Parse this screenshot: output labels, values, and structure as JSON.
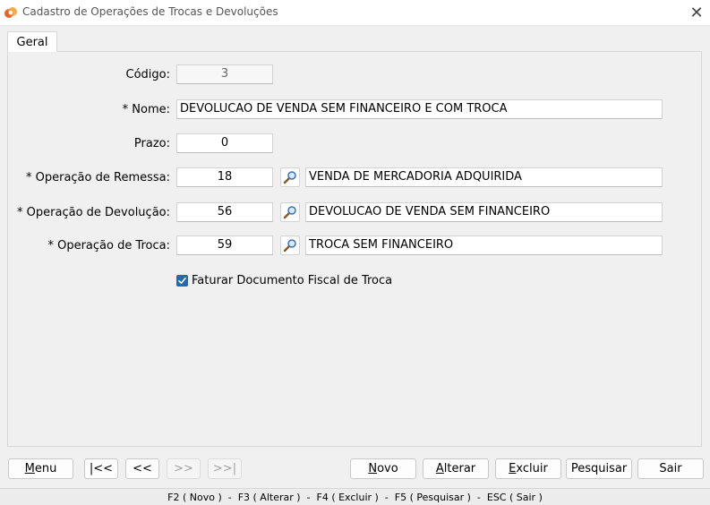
{
  "window": {
    "title": "Cadastro de Operações de Trocas e Devoluções",
    "close_glyph": "✕"
  },
  "tabs": [
    {
      "label": "Geral",
      "active": true
    }
  ],
  "form": {
    "codigo": {
      "label": "Código:",
      "value": "3"
    },
    "nome": {
      "label": "* Nome:",
      "value": "DEVOLUCAO DE VENDA SEM FINANCEIRO E COM TROCA"
    },
    "prazo": {
      "label": "Prazo:",
      "value": "0"
    },
    "remessa": {
      "label": "* Operação de Remessa:",
      "code": "18",
      "description": "VENDA DE MERCADORIA ADQUIRIDA"
    },
    "devolucao": {
      "label": "* Operação de Devolução:",
      "code": "56",
      "description": "DEVOLUCAO DE VENDA SEM FINANCEIRO"
    },
    "troca": {
      "label": "* Operação de Troca:",
      "code": "59",
      "description": "TROCA SEM FINANCEIRO"
    },
    "faturar": {
      "label": "Faturar Documento Fiscal de Troca",
      "checked": true
    }
  },
  "buttons": {
    "menu": {
      "mnemonic": "M",
      "rest": "enu"
    },
    "first": "|<<",
    "prev": "<<",
    "next": ">>",
    "last": ">>|",
    "novo": {
      "mnemonic": "N",
      "rest": "ovo"
    },
    "alterar": {
      "mnemonic": "A",
      "rest": "lterar"
    },
    "excluir": {
      "mnemonic": "E",
      "rest": "xcluir"
    },
    "pesquisar": "Pesquisar",
    "sair": "Sair"
  },
  "status": "F2 ( Novo )  -  F3 ( Alterar )  -  F4 ( Excluir )  -  F5 ( Pesquisar )  -  ESC ( Sair )",
  "colors": {
    "accent": "#1f6cb4",
    "window_bg": "#f0f0f0"
  }
}
